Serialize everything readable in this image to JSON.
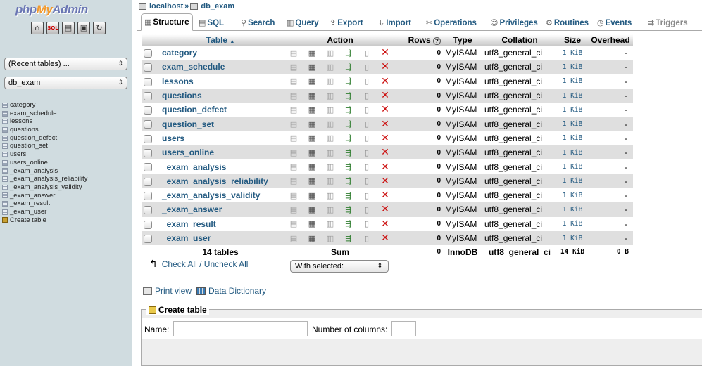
{
  "nav": {
    "logo": {
      "php": "php",
      "my": "My",
      "admin": "Admin"
    },
    "icons": [
      "home-icon",
      "sql-query-icon",
      "docs-icon",
      "help-icon",
      "reload-icon"
    ],
    "recent_tables": "(Recent tables) ...",
    "database": "db_exam",
    "tables": [
      "category",
      "exam_schedule",
      "lessons",
      "questions",
      "question_defect",
      "question_set",
      "users",
      "users_online",
      "_exam_analysis",
      "_exam_analysis_reliability",
      "_exam_analysis_validity",
      "_exam_answer",
      "_exam_result",
      "_exam_user"
    ],
    "create_table": "Create table"
  },
  "breadcrumb": {
    "server": "localhost",
    "separator": "»",
    "database": "db_exam"
  },
  "tabs": {
    "structure": "Structure",
    "sql": "SQL",
    "search": "Search",
    "query": "Query",
    "export": "Export",
    "import": "Import",
    "operations": "Operations",
    "privileges": "Privileges",
    "routines": "Routines",
    "events": "Events",
    "triggers": "Triggers"
  },
  "table": {
    "headers": {
      "table": "Table",
      "sort_arrow": "▲",
      "action": "Action",
      "rows": "Rows",
      "rows_help": "?",
      "type": "Type",
      "collation": "Collation",
      "size": "Size",
      "overhead": "Overhead"
    },
    "rows": [
      {
        "name": "category",
        "rows": "0",
        "type": "MyISAM",
        "collation": "utf8_general_ci",
        "size": "1 KiB",
        "overhead": "-"
      },
      {
        "name": "exam_schedule",
        "rows": "0",
        "type": "MyISAM",
        "collation": "utf8_general_ci",
        "size": "1 KiB",
        "overhead": "-"
      },
      {
        "name": "lessons",
        "rows": "0",
        "type": "MyISAM",
        "collation": "utf8_general_ci",
        "size": "1 KiB",
        "overhead": "-"
      },
      {
        "name": "questions",
        "rows": "0",
        "type": "MyISAM",
        "collation": "utf8_general_ci",
        "size": "1 KiB",
        "overhead": "-"
      },
      {
        "name": "question_defect",
        "rows": "0",
        "type": "MyISAM",
        "collation": "utf8_general_ci",
        "size": "1 KiB",
        "overhead": "-"
      },
      {
        "name": "question_set",
        "rows": "0",
        "type": "MyISAM",
        "collation": "utf8_general_ci",
        "size": "1 KiB",
        "overhead": "-"
      },
      {
        "name": "users",
        "rows": "0",
        "type": "MyISAM",
        "collation": "utf8_general_ci",
        "size": "1 KiB",
        "overhead": "-"
      },
      {
        "name": "users_online",
        "rows": "0",
        "type": "MyISAM",
        "collation": "utf8_general_ci",
        "size": "1 KiB",
        "overhead": "-"
      },
      {
        "name": "_exam_analysis",
        "rows": "0",
        "type": "MyISAM",
        "collation": "utf8_general_ci",
        "size": "1 KiB",
        "overhead": "-"
      },
      {
        "name": "_exam_analysis_reliability",
        "rows": "0",
        "type": "MyISAM",
        "collation": "utf8_general_ci",
        "size": "1 KiB",
        "overhead": "-"
      },
      {
        "name": "_exam_analysis_validity",
        "rows": "0",
        "type": "MyISAM",
        "collation": "utf8_general_ci",
        "size": "1 KiB",
        "overhead": "-"
      },
      {
        "name": "_exam_answer",
        "rows": "0",
        "type": "MyISAM",
        "collation": "utf8_general_ci",
        "size": "1 KiB",
        "overhead": "-"
      },
      {
        "name": "_exam_result",
        "rows": "0",
        "type": "MyISAM",
        "collation": "utf8_general_ci",
        "size": "1 KiB",
        "overhead": "-"
      },
      {
        "name": "_exam_user",
        "rows": "0",
        "type": "MyISAM",
        "collation": "utf8_general_ci",
        "size": "1 KiB",
        "overhead": "-"
      }
    ],
    "footer": {
      "count": "14 tables",
      "sum": "Sum",
      "rows": "0",
      "type": "InnoDB",
      "collation": "utf8_general_ci",
      "size": "14 KiB",
      "overhead": "0 B"
    }
  },
  "bulk": {
    "check_all": "Check All",
    "slash": " / ",
    "uncheck_all": "Uncheck All",
    "with_selected": "With selected:"
  },
  "links": {
    "print_view": "Print view",
    "data_dictionary": "Data Dictionary"
  },
  "create_table_form": {
    "legend": "Create table",
    "name_label": "Name:",
    "columns_label": "Number of columns:"
  }
}
